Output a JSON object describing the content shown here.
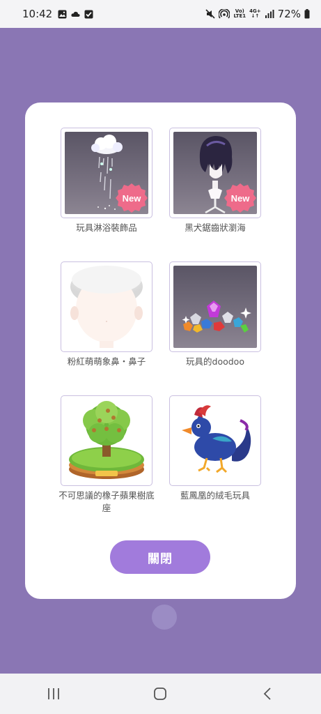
{
  "status_bar": {
    "time": "10:42",
    "network_top": "Vo)",
    "network_bottom": "LTE1",
    "data_top": "4G+",
    "data_bottom": "↓↑",
    "battery": "72%",
    "icons": [
      "image-icon",
      "cloud-icon",
      "checkbox-icon",
      "mute-icon",
      "hotspot-icon",
      "signal-icon",
      "battery-icon"
    ]
  },
  "dialog": {
    "items": [
      {
        "label": "玩具淋浴裝飾品",
        "icon": "rain-cloud-shower-icon",
        "badge": "New"
      },
      {
        "label": "黑犬鋸齒狀瀏海",
        "icon": "black-hair-wig-icon",
        "badge": "New"
      },
      {
        "label": "粉紅萌萌象鼻・鼻子",
        "icon": "pink-elephant-nose-icon",
        "badge": ""
      },
      {
        "label": "玩具的doodoo",
        "icon": "gem-pile-icon",
        "badge": ""
      },
      {
        "label": "不可思議的橡子蘋果樹底座",
        "icon": "acorn-tree-base-icon",
        "badge": ""
      },
      {
        "label": "藍鳳凰的絨毛玩具",
        "icon": "blue-phoenix-plush-icon",
        "badge": ""
      }
    ],
    "close_label": "關閉"
  },
  "colors": {
    "background": "#8a76b4",
    "accent": "#a17bdc",
    "badge": "#ee6b8a"
  }
}
